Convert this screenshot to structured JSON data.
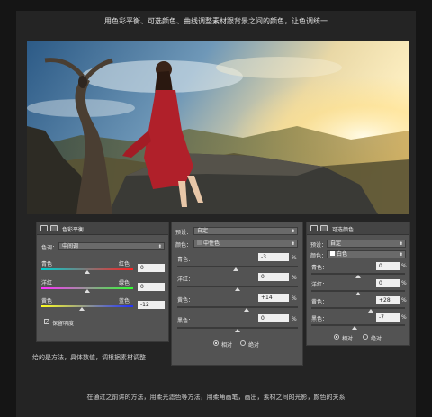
{
  "top_caption": "用色彩平衡、可选颜色、曲线调整素材跟背景之间的颜色，让色调统一",
  "mid_caption": "给的是方法，具体数值，调根据素材调整",
  "bottom_caption": "在通过之前讲的方法，用柔光滤色等方法，用柔角画笔，画出，素材之间的光影，颜色的关系",
  "color_balance": {
    "title": "色彩平衡",
    "tone_label": "色调：",
    "tone_value": "中间调",
    "sliders": [
      {
        "left": "青色",
        "right": "红色",
        "value": "0"
      },
      {
        "left": "洋红",
        "right": "绿色",
        "value": "0"
      },
      {
        "left": "黄色",
        "right": "蓝色",
        "value": "-12"
      }
    ],
    "preserve_label": "保留明度",
    "preserve_checked": true
  },
  "selective_color_mid": {
    "preset_label": "预设：",
    "preset_value": "自定",
    "color_label": "颜色：",
    "color_value": "中性色",
    "sliders": [
      {
        "label": "青色：",
        "value": "-3",
        "unit": "%"
      },
      {
        "label": "洋红：",
        "value": "0",
        "unit": "%"
      },
      {
        "label": "黄色：",
        "value": "+14",
        "unit": "%"
      },
      {
        "label": "黑色：",
        "value": "0",
        "unit": "%"
      }
    ],
    "mode_relative": "相对",
    "mode_absolute": "绝对",
    "mode_selected": "relative"
  },
  "selective_color_right": {
    "title": "可选颜色",
    "preset_label": "预设：",
    "preset_value": "自定",
    "color_label": "颜色：",
    "color_value": "白色",
    "sliders": [
      {
        "label": "青色：",
        "value": "0",
        "unit": "%"
      },
      {
        "label": "洋红：",
        "value": "0",
        "unit": "%"
      },
      {
        "label": "黄色：",
        "value": "+28",
        "unit": "%"
      },
      {
        "label": "黑色：",
        "value": "-7",
        "unit": "%"
      }
    ],
    "mode_relative": "相对",
    "mode_absolute": "绝对",
    "mode_selected": "relative"
  },
  "colors": {
    "background": "#151515",
    "frame": "#242424",
    "panel": "#535353",
    "dress": "#b0202a",
    "sky_top": "#2d5f88",
    "sky_glow": "#ffe6a0"
  }
}
